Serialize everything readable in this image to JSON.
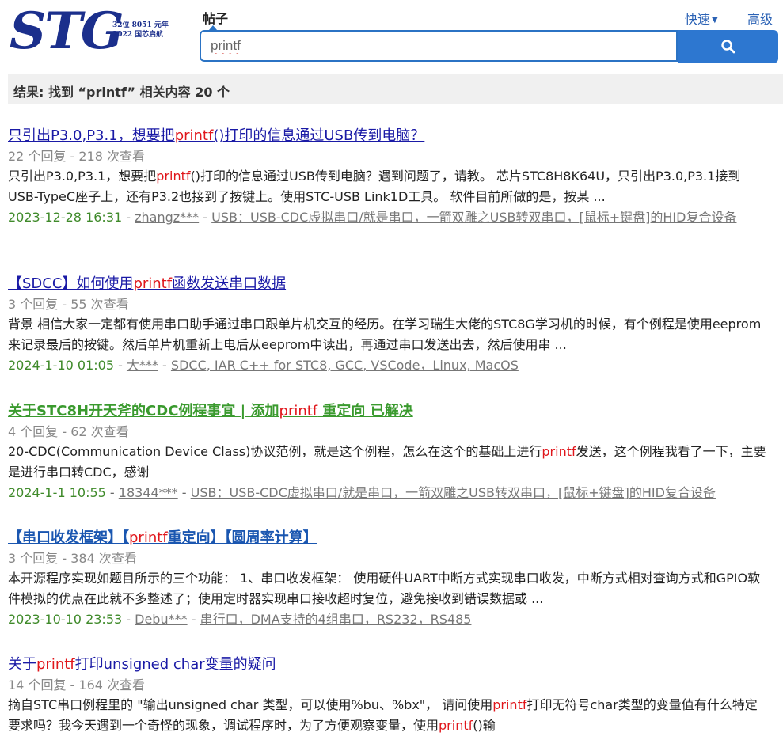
{
  "header": {
    "logo_text": "STG",
    "logo_line1": "32位 8051 元年",
    "logo_line2": "2022 国芯启航",
    "scope_label": "帖子",
    "quick_label": "快速",
    "advanced_label": "高级",
    "search_value": "printf"
  },
  "summary": {
    "text": "结果: 找到 “printf” 相关内容 20 个"
  },
  "results": [
    {
      "title_a": "只引出P3.0,P3.1，想要把",
      "title_hl": "printf",
      "title_b": "()打印的信息通过USB传到电脑？",
      "stats": "22 个回复 - 218 次查看",
      "snip_a": "只引出P3.0,P3.1，想要把",
      "snip_hl": "printf",
      "snip_b": "()打印的信息通过USB传到电脑？遇到问题了，请教。 芯片STC8H8K64U，只引出P3.0,P3.1接到USB-TypeC座子上，还有P3.2也接到了按键上。使用STC-USB Link1D工具。 软件目前所做的是，按某 ...",
      "snip_hl2": "",
      "snip_c": "",
      "date": "2023-12-28 16:31",
      "author": "zhangz***",
      "forum": "USB：USB-CDC虚拟串口/就是串口，一箭双雕之USB转双串口，[鼠标+键盘]的HID复合设备"
    },
    {
      "title_a": "【SDCC】如何使用",
      "title_hl": "printf",
      "title_b": "函数发送串口数据",
      "stats": "3 个回复 - 55 次查看",
      "snip_a": "背景 相信大家一定都有使用串口助手通过串口跟单片机交互的经历。在学习瑞生大佬的STC8G学习机的时候，有个例程是使用eeprom来记录最后的按键。然后单片机重新上电后从eeprom中读出，再通过串口发送出去，然后使用串 ...",
      "snip_hl": "",
      "snip_b": "",
      "snip_hl2": "",
      "snip_c": "",
      "date": "2024-1-10 01:05",
      "author": "大***",
      "forum": "SDCC, IAR C++ for STC8, GCC, VSCode，Linux, MacOS"
    },
    {
      "title_a": "关于STC8H开天斧的CDC例程事宜 | 添加",
      "title_hl": "printf",
      "title_b": " 重定向 已解决",
      "stats": "4 个回复 - 62 次查看",
      "snip_a": "20-CDC(Communication Device Class)协议范例，就是这个例程，怎么在这个的基础上进行",
      "snip_hl": "printf",
      "snip_b": "发送，这个例程我看了一下，主要是进行串口转CDC，感谢",
      "snip_hl2": "",
      "snip_c": "",
      "date": "2024-1-1 10:55",
      "author": "18344***",
      "forum": "USB：USB-CDC虚拟串口/就是串口，一箭双雕之USB转双串口，[鼠标+键盘]的HID复合设备"
    },
    {
      "title_a": "【串口收发框架】【",
      "title_hl": "printf",
      "title_b": "重定向】【圆周率计算】",
      "stats": "3 个回复 - 384 次查看",
      "snip_a": "本开源程序实现如题目所示的三个功能： 1、串口收发框架： 使用硬件UART中断方式实现串口收发，中断方式相对查询方式和GPIO软件模拟的优点在此就不多整述了；使用定时器实现串口接收超时复位，避免接收到错误数据或 ...",
      "snip_hl": "",
      "snip_b": "",
      "snip_hl2": "",
      "snip_c": "",
      "date": "2023-10-10 23:53",
      "author": "Debu***",
      "forum": "串行口，DMA支持的4组串口，RS232，RS485"
    },
    {
      "title_a": "关于",
      "title_hl": "printf",
      "title_b": "打印unsigned char变量的疑问",
      "stats": "14 个回复 - 164 次查看",
      "snip_a": "摘自STC串口例程里的 \"输出unsigned char 类型，可以使用%bu、%bx\"， 请问使用",
      "snip_hl": "printf",
      "snip_b": "打印无符号char类型的变量值有什么特定要求吗？我今天遇到一个奇怪的现象，调试程序时，为了方便观察变量，使用",
      "snip_hl2": "printf",
      "snip_c": "()输",
      "date": "",
      "author": "",
      "forum": ""
    }
  ]
}
